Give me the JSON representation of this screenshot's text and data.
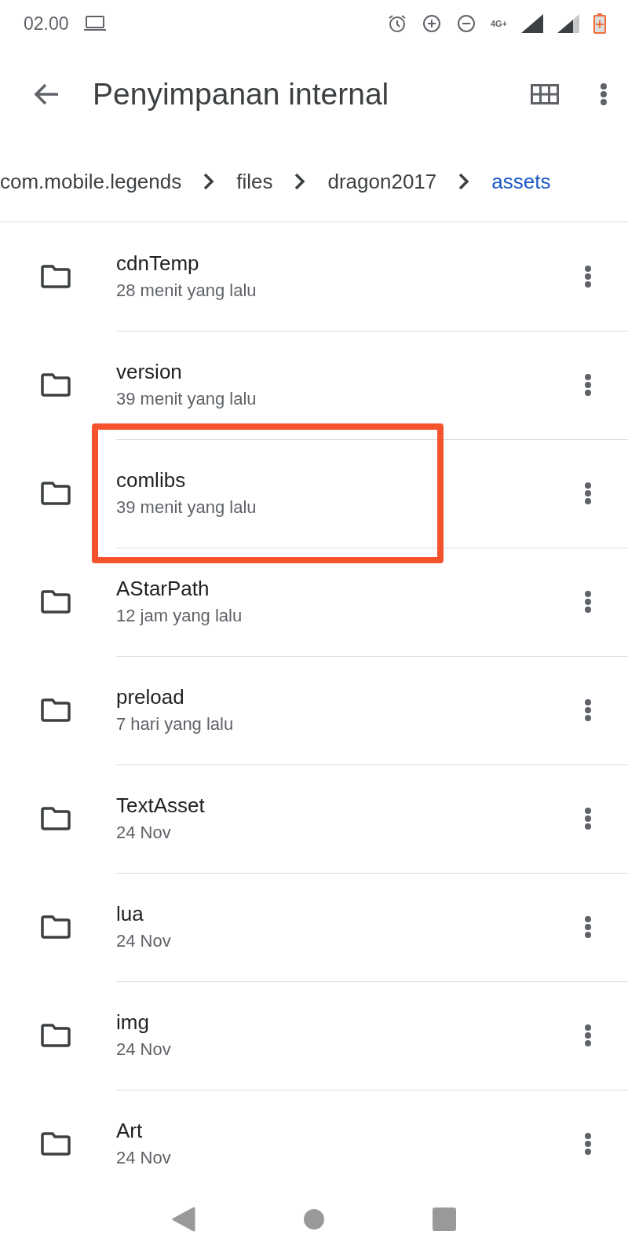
{
  "status_bar": {
    "time": "02.00",
    "network": "4G+"
  },
  "toolbar": {
    "title": "Penyimpanan internal"
  },
  "breadcrumb": [
    {
      "label": "com.mobile.legends",
      "selected": false
    },
    {
      "label": "files",
      "selected": false
    },
    {
      "label": "dragon2017",
      "selected": false
    },
    {
      "label": "assets",
      "selected": true
    }
  ],
  "folders": [
    {
      "name": "cdnTemp",
      "modified": "28 menit yang lalu",
      "highlighted": false
    },
    {
      "name": "version",
      "modified": "39 menit yang lalu",
      "highlighted": false
    },
    {
      "name": "comlibs",
      "modified": "39 menit yang lalu",
      "highlighted": true
    },
    {
      "name": "AStarPath",
      "modified": "12 jam yang lalu",
      "highlighted": false
    },
    {
      "name": "preload",
      "modified": "7 hari yang lalu",
      "highlighted": false
    },
    {
      "name": "TextAsset",
      "modified": "24 Nov",
      "highlighted": false
    },
    {
      "name": "lua",
      "modified": "24 Nov",
      "highlighted": false
    },
    {
      "name": "img",
      "modified": "24 Nov",
      "highlighted": false
    },
    {
      "name": "Art",
      "modified": "24 Nov",
      "highlighted": false
    }
  ]
}
